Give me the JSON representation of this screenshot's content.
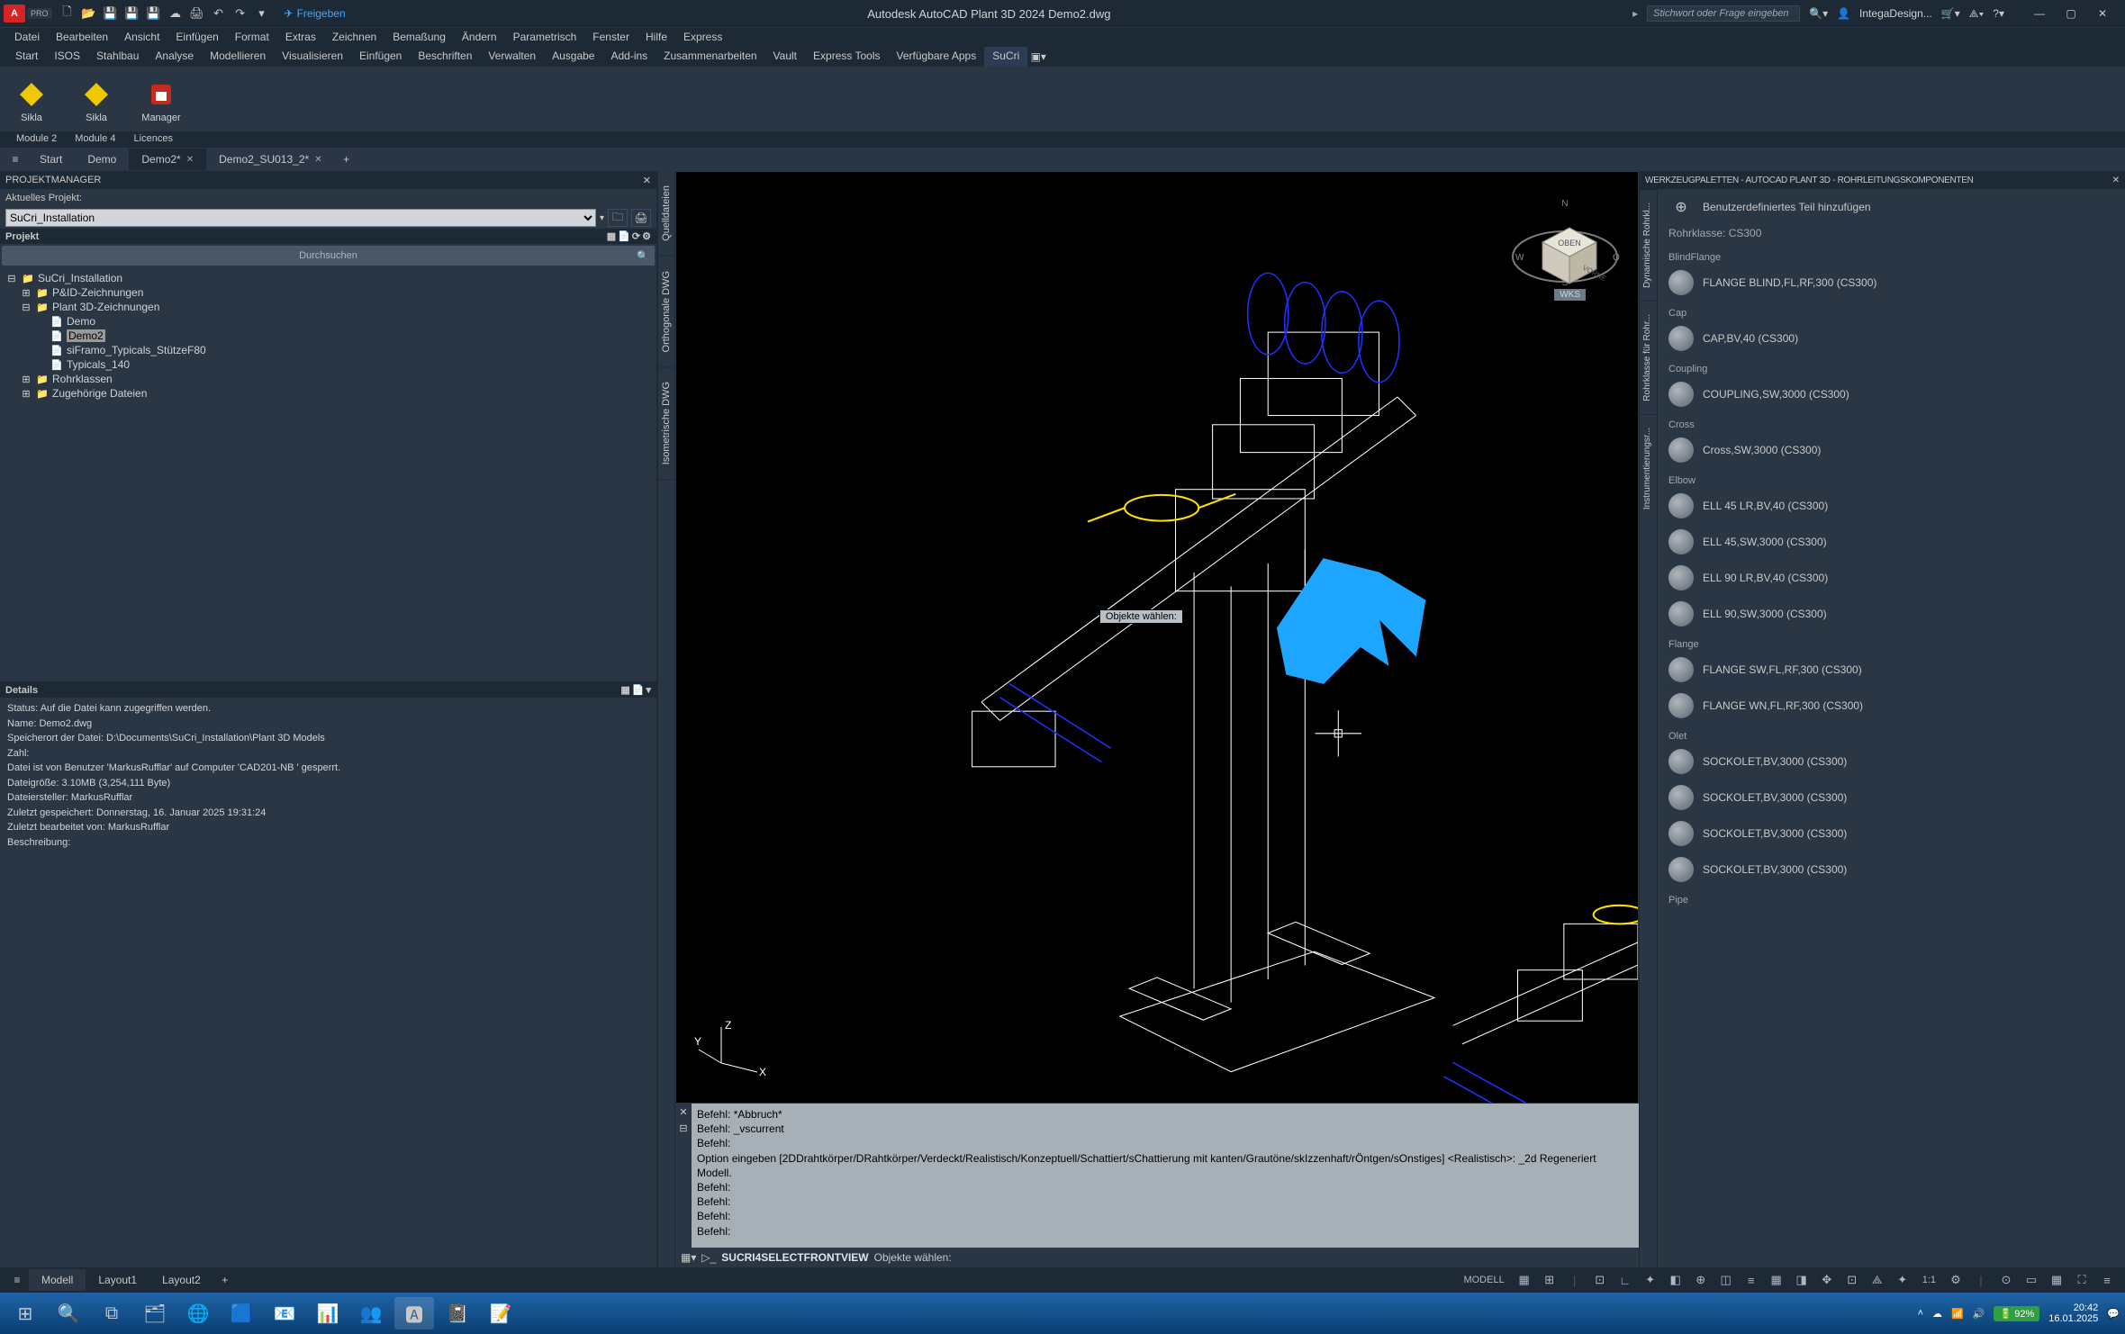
{
  "app": {
    "title": "Autodesk AutoCAD Plant 3D 2024   Demo2.dwg",
    "logo_text": "A",
    "pro": "PRO",
    "share": "Freigeben",
    "search_placeholder": "Stichwort oder Frage eingeben",
    "user": "IntegaDesign..."
  },
  "menu": [
    "Datei",
    "Bearbeiten",
    "Ansicht",
    "Einfügen",
    "Format",
    "Extras",
    "Zeichnen",
    "Bemaßung",
    "Ändern",
    "Parametrisch",
    "Fenster",
    "Hilfe",
    "Express"
  ],
  "ribbon_tabs": [
    "Start",
    "ISOS",
    "Stahlbau",
    "Analyse",
    "Modellieren",
    "Visualisieren",
    "Einfügen",
    "Beschriften",
    "Verwalten",
    "Ausgabe",
    "Add-ins",
    "Zusammenarbeiten",
    "Vault",
    "Express Tools",
    "Verfügbare Apps",
    "SuCri"
  ],
  "ribbon_tabs_active": 15,
  "ribbon_buttons": [
    {
      "label": "Sikla",
      "color": "#f0c800"
    },
    {
      "label": "Sikla",
      "color": "#f0c800"
    },
    {
      "label": "Manager",
      "color": "#c42b1c"
    }
  ],
  "ribbon_sub": [
    "Module 2",
    "Module 4",
    "Licences"
  ],
  "doc_tabs": {
    "items": [
      {
        "label": "Start",
        "closable": false,
        "active": false
      },
      {
        "label": "Demo",
        "closable": false,
        "active": false
      },
      {
        "label": "Demo2*",
        "closable": true,
        "active": true
      },
      {
        "label": "Demo2_SU013_2*",
        "closable": true,
        "active": false
      }
    ]
  },
  "project": {
    "panel_title": "PROJEKTMANAGER",
    "current_label": "Aktuelles Projekt:",
    "current_value": "SuCri_Installation",
    "section": "Projekt",
    "search": "Durchsuchen",
    "tree": [
      {
        "indent": 0,
        "exp": "⊟",
        "icon": "📁",
        "label": "SuCri_Installation"
      },
      {
        "indent": 1,
        "exp": "⊞",
        "icon": "📁",
        "label": "P&ID-Zeichnungen"
      },
      {
        "indent": 1,
        "exp": "⊟",
        "icon": "📁",
        "label": "Plant 3D-Zeichnungen"
      },
      {
        "indent": 2,
        "exp": "",
        "icon": "📄",
        "label": "Demo"
      },
      {
        "indent": 2,
        "exp": "",
        "icon": "📄",
        "label": "Demo2",
        "selected": true
      },
      {
        "indent": 2,
        "exp": "",
        "icon": "📄",
        "label": "siFramo_Typicals_StützeF80"
      },
      {
        "indent": 2,
        "exp": "",
        "icon": "📄",
        "label": "Typicals_140"
      },
      {
        "indent": 1,
        "exp": "⊞",
        "icon": "📁",
        "label": "Rohrklassen"
      },
      {
        "indent": 1,
        "exp": "⊞",
        "icon": "📁",
        "label": "Zugehörige Dateien"
      }
    ]
  },
  "details": {
    "title": "Details",
    "lines": [
      "Status: Auf die Datei kann zugegriffen werden.",
      "Name: Demo2.dwg",
      "Speicherort der Datei: D:\\Documents\\SuCri_Installation\\Plant 3D Models",
      "Zahl:",
      "Datei ist von Benutzer 'MarkusRufflar' auf Computer 'CAD201-NB ' gesperrt.",
      "Dateigröße: 3.10MB (3,254,111 Byte)",
      "Dateiersteller: MarkusRufflar",
      "Zuletzt gespeichert: Donnerstag, 16. Januar 2025 19:31:24",
      "Zuletzt bearbeitet von: MarkusRufflar",
      "Beschreibung:"
    ]
  },
  "side_strips": [
    "Quelldateien",
    "Orthogonale DWG",
    "Isometrische DWG"
  ],
  "viewport": {
    "tooltip": "Objekte wählen:",
    "wcs": "WKS",
    "axes": {
      "x": "X",
      "y": "Y",
      "z": "Z"
    }
  },
  "command": {
    "lines": [
      "Befehl: *Abbruch*",
      "Befehl: _vscurrent",
      "Befehl:",
      "Option eingeben [2DDrahtkörper/DRahtkörper/Verdeckt/Realistisch/Konzeptuell/Schattiert/sChattierung mit kanten/Grautöne/skIzzenhaft/rÖntgen/sOnstiges] <Realistisch>: _2d Regeneriert Modell.",
      "Befehl:",
      "Befehl:",
      "Befehl:",
      "Befehl:"
    ],
    "prompt_cmd": "SUCRI4SELECTFRONTVIEW",
    "prompt_tail": "Objekte wählen:"
  },
  "palettes": {
    "title": "WERKZEUGPALETTEN - AUTOCAD PLANT 3D - ROHRLEITUNGSKOMPONENTEN",
    "side_tabs": [
      "Dynamische Rohrkl...",
      "Rohrklasse für Rohr...",
      "Instrumentierungsr..."
    ],
    "custom_add": "Benutzerdefiniertes Teil hinzufügen",
    "class": "Rohrklasse: CS300",
    "groups": [
      {
        "name": "BlindFlange",
        "items": [
          "FLANGE BLIND,FL,RF,300 (CS300)"
        ]
      },
      {
        "name": "Cap",
        "items": [
          "CAP,BV,40 (CS300)"
        ]
      },
      {
        "name": "Coupling",
        "items": [
          "COUPLING,SW,3000 (CS300)"
        ]
      },
      {
        "name": "Cross",
        "items": [
          "Cross,SW,3000 (CS300)"
        ]
      },
      {
        "name": "Elbow",
        "items": [
          "ELL 45 LR,BV,40 (CS300)",
          "ELL 45,SW,3000 (CS300)",
          "ELL 90 LR,BV,40 (CS300)",
          "ELL 90,SW,3000 (CS300)"
        ]
      },
      {
        "name": "Flange",
        "items": [
          "FLANGE SW,FL,RF,300 (CS300)",
          "FLANGE WN,FL,RF,300 (CS300)"
        ]
      },
      {
        "name": "Olet",
        "items": [
          "SOCKOLET,BV,3000 (CS300)",
          "SOCKOLET,BV,3000 (CS300)",
          "SOCKOLET,BV,3000 (CS300)",
          "SOCKOLET,BV,3000 (CS300)"
        ]
      },
      {
        "name": "Pipe",
        "items": []
      }
    ]
  },
  "layout_tabs": [
    "Modell",
    "Layout1",
    "Layout2"
  ],
  "layout_active": 0,
  "status": {
    "model": "MODELL",
    "scale": "1:1"
  },
  "taskbar": {
    "battery": "92%",
    "time": "20:42",
    "date": "16.01.2025"
  }
}
